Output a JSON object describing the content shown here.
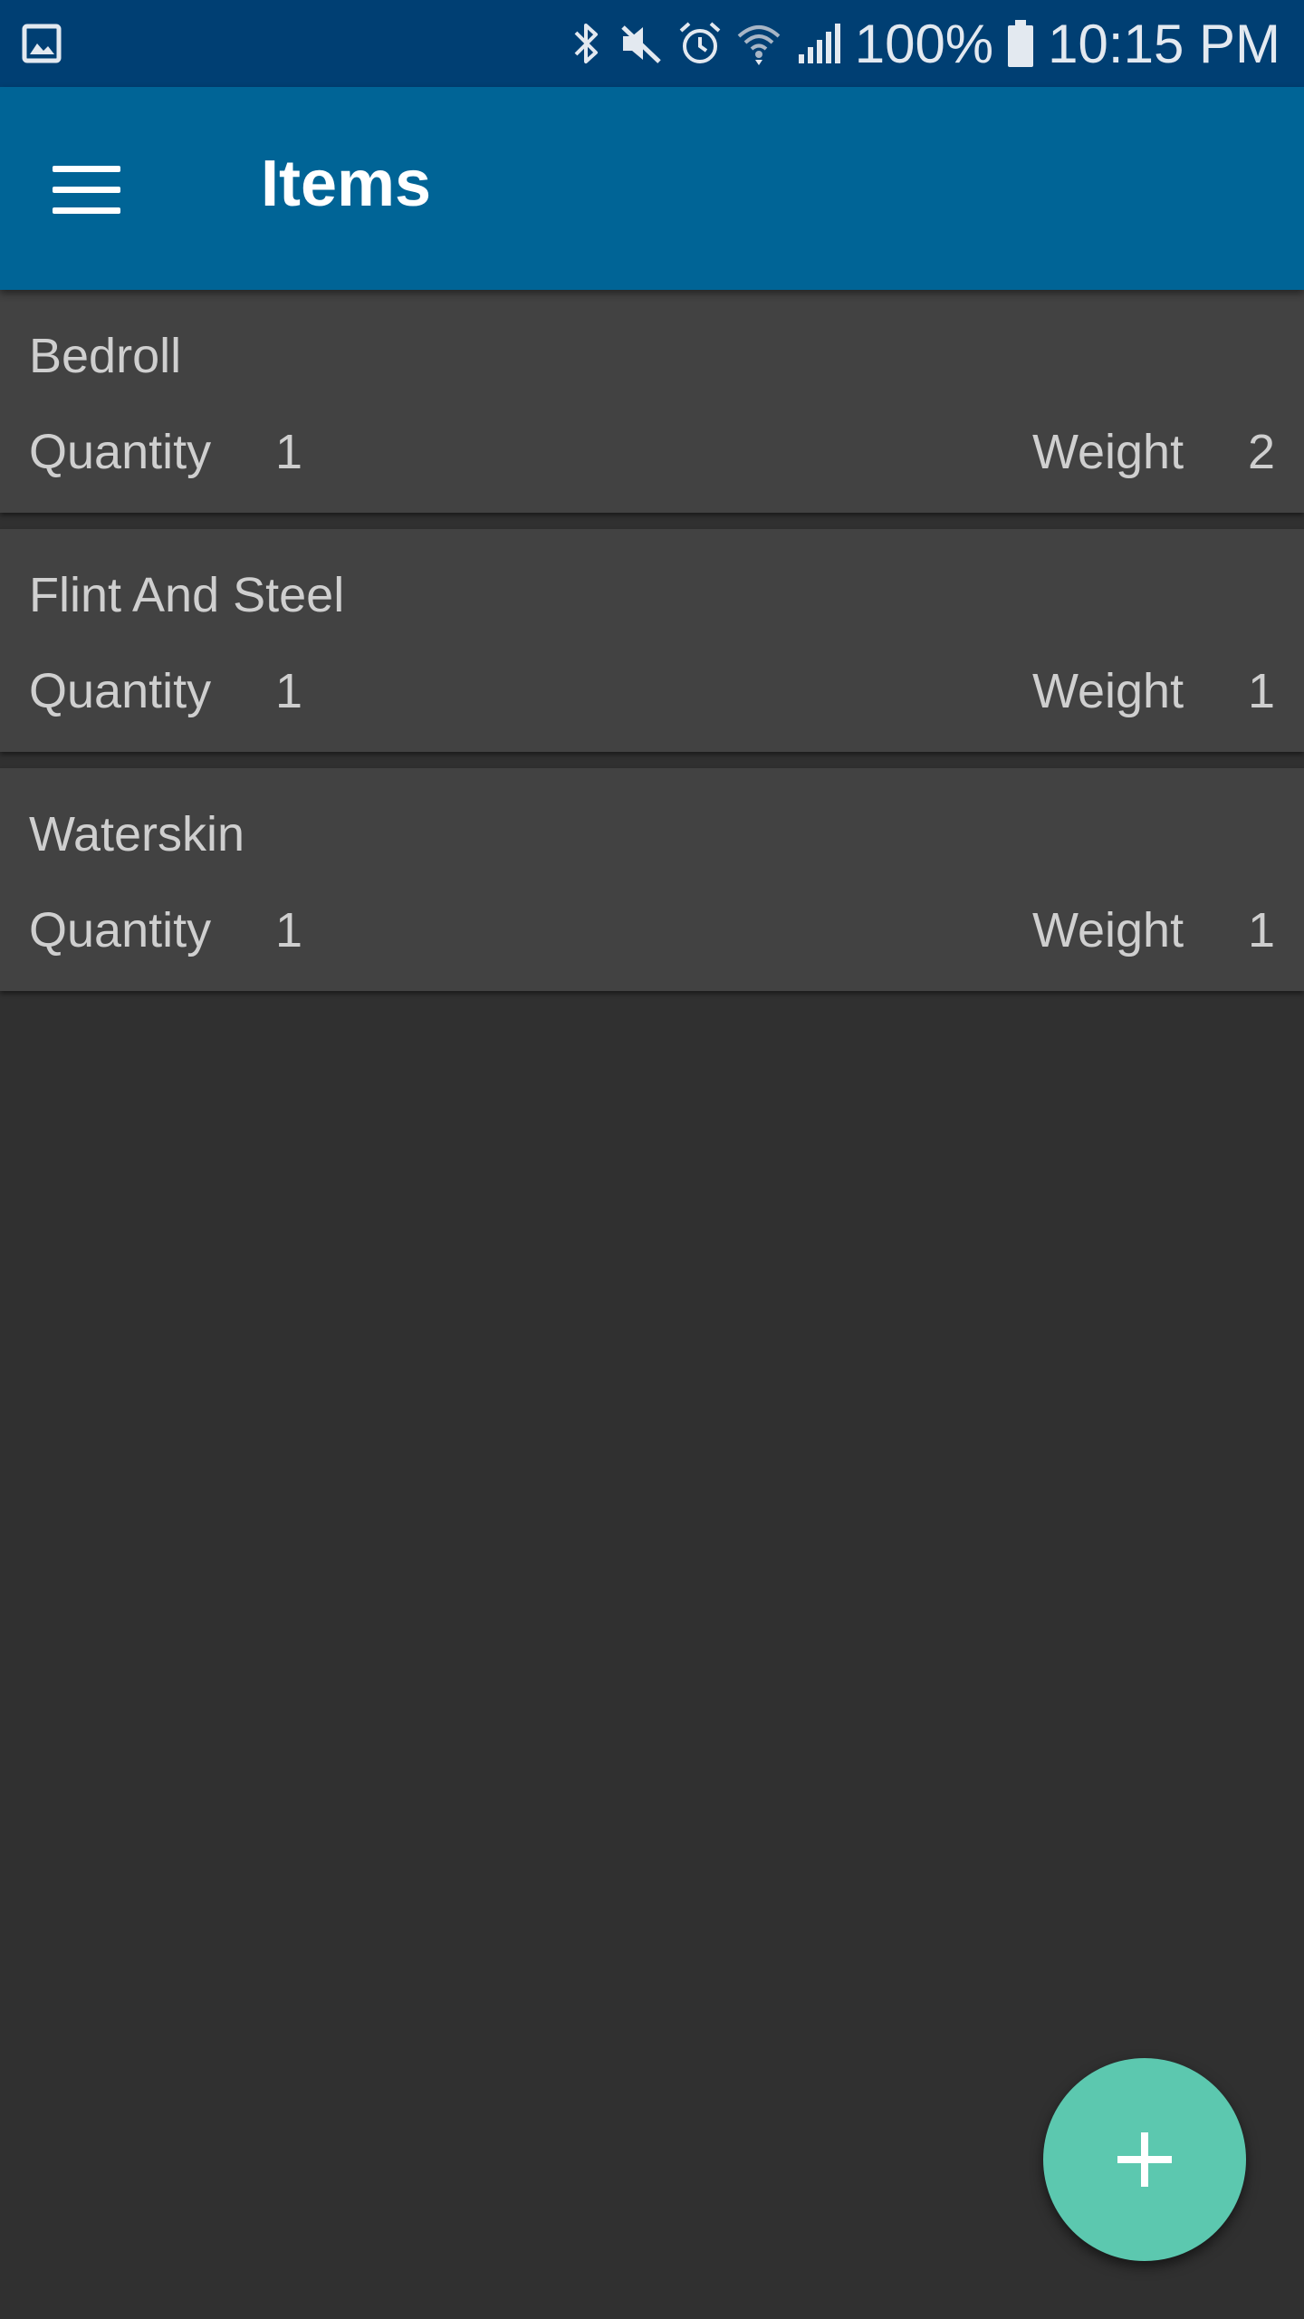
{
  "status_bar": {
    "icons": [
      "gallery-icon",
      "bluetooth-icon",
      "mute-icon",
      "alarm-icon",
      "wifi-icon",
      "signal-icon",
      "battery-icon"
    ],
    "battery": "100%",
    "time": "10:15 PM"
  },
  "app_bar": {
    "title": "Items",
    "menu_icon": "hamburger-menu-icon"
  },
  "items": [
    {
      "name": "Bedroll",
      "quantity_label": "Quantity",
      "quantity": "1",
      "weight_label": "Weight",
      "weight": "2"
    },
    {
      "name": "Flint And Steel",
      "quantity_label": "Quantity",
      "quantity": "1",
      "weight_label": "Weight",
      "weight": "1"
    },
    {
      "name": "Waterskin",
      "quantity_label": "Quantity",
      "quantity": "1",
      "weight_label": "Weight",
      "weight": "1"
    }
  ],
  "fab": {
    "icon": "plus-icon"
  },
  "colors": {
    "status_bar": "#003f73",
    "app_bar": "#006496",
    "background": "#303030",
    "card": "#424242",
    "fab": "#5cc8af"
  }
}
